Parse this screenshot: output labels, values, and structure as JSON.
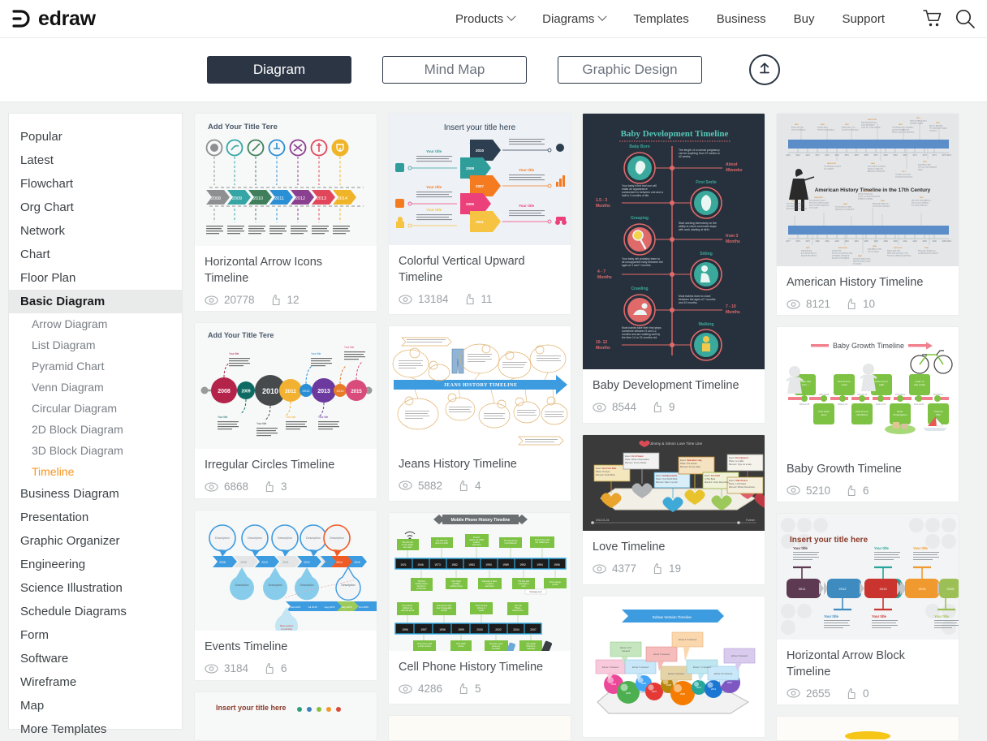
{
  "header": {
    "brand": "edraw",
    "nav": [
      {
        "label": "Products",
        "caret": true
      },
      {
        "label": "Diagrams",
        "caret": true
      },
      {
        "label": "Templates",
        "caret": false
      },
      {
        "label": "Business",
        "caret": false
      },
      {
        "label": "Buy",
        "caret": false
      },
      {
        "label": "Support",
        "caret": false
      }
    ],
    "icons": [
      {
        "name": "cart-icon"
      },
      {
        "name": "search-icon"
      }
    ]
  },
  "switchbar": {
    "buttons": [
      {
        "label": "Diagram",
        "active": true
      },
      {
        "label": "Mind Map",
        "active": false
      },
      {
        "label": "Graphic Design",
        "active": false
      }
    ],
    "upload_icon": "upload-icon"
  },
  "sidebar": {
    "items": [
      {
        "label": "Popular",
        "type": "top"
      },
      {
        "label": "Latest",
        "type": "top"
      },
      {
        "label": "Flowchart",
        "type": "top"
      },
      {
        "label": "Org Chart",
        "type": "top"
      },
      {
        "label": "Network",
        "type": "top"
      },
      {
        "label": "Chart",
        "type": "top"
      },
      {
        "label": "Floor Plan",
        "type": "top"
      },
      {
        "label": "Basic Diagram",
        "type": "top",
        "active": true
      },
      {
        "label": "Arrow Diagram",
        "type": "sub"
      },
      {
        "label": "List Diagram",
        "type": "sub"
      },
      {
        "label": "Pyramid Chart",
        "type": "sub"
      },
      {
        "label": "Venn Diagram",
        "type": "sub"
      },
      {
        "label": "Circular Diagram",
        "type": "sub"
      },
      {
        "label": "2D Block Diagram",
        "type": "sub"
      },
      {
        "label": "3D Block Diagram",
        "type": "sub"
      },
      {
        "label": "Timeline",
        "type": "sub",
        "selected": true
      },
      {
        "label": "Business Diagram",
        "type": "top"
      },
      {
        "label": "Presentation",
        "type": "top"
      },
      {
        "label": "Graphic Organizer",
        "type": "top"
      },
      {
        "label": "Engineering",
        "type": "top"
      },
      {
        "label": "Science Illustration",
        "type": "top"
      },
      {
        "label": "Schedule Diagrams",
        "type": "top"
      },
      {
        "label": "Form",
        "type": "top"
      },
      {
        "label": "Software",
        "type": "top"
      },
      {
        "label": "Wireframe",
        "type": "top"
      },
      {
        "label": "Map",
        "type": "top"
      },
      {
        "label": "More Templates",
        "type": "top"
      }
    ]
  },
  "colors": {
    "accent": "#f7941e",
    "dark": "#2b3544",
    "card_bg": "#ffffff",
    "page_bg": "#f1f3f3"
  },
  "cards": {
    "c1": {
      "title": "Horizontal Arrow Icons Timeline",
      "views": "20778",
      "likes": "12",
      "thumb_title": "Add Your Title Tere",
      "years": [
        "2008",
        "2009",
        "2010",
        "2011",
        "2012",
        "2013",
        "2014"
      ],
      "arrow_colors": [
        "#8d8f91",
        "#35a5a5",
        "#3f7f5c",
        "#2a8fd4",
        "#8b3f8f",
        "#e2465a",
        "#f0b429"
      ]
    },
    "c2": {
      "title": "Irregular Circles Timeline",
      "views": "6868",
      "likes": "3",
      "thumb_title": "Add Your Title Tere",
      "years": [
        "2008",
        "2009",
        "2010",
        "2011",
        "",
        "2013",
        "",
        "2015"
      ],
      "circle_colors": [
        "#b4234a",
        "#0d6b63",
        "#474a4d",
        "#f2b131",
        "#2a8fd4",
        "#6c3a9e",
        "#e87b26",
        "#d94b7a"
      ]
    },
    "c3": {
      "title": "Events Timeline",
      "views": "3184",
      "likes": "6",
      "bubble_label": "Description",
      "seg_years": [
        "2008",
        "2009",
        "2010",
        "2011",
        "2012",
        "2013",
        "2014",
        "2015"
      ],
      "lower_labels": [
        "Feb 2015",
        "Jul 2015",
        "Aug 2015",
        "Sep 2015",
        "Oct 2015"
      ],
      "drop_label": "New version is coming!"
    },
    "c4": {
      "title": "Colorful Vertical Upward Timeline",
      "views": "13184",
      "likes": "11",
      "thumb_title": "Insert your title here",
      "years": [
        "2010",
        "2008",
        "2007",
        "2009",
        "2011"
      ],
      "side_label": "Your title",
      "colors": [
        "#2c3e50",
        "#2f9e9b",
        "#f47b20",
        "#ec407a",
        "#f6c343"
      ]
    },
    "c5": {
      "title": "Jeans History Timeline",
      "views": "5882",
      "likes": "4",
      "banner": "JEANS HISTORY TIMELINE"
    },
    "c6": {
      "title": "Cell Phone History Timeline",
      "views": "4286",
      "likes": "5",
      "banner": "Mobile Phone History Timeline",
      "row1_years": [
        "1921",
        "1946",
        "1973",
        "1982",
        "1983",
        "1990",
        "1989",
        "1992",
        "1994",
        "1996"
      ],
      "row2_years": [
        "1996",
        "1997",
        "1998",
        "1999",
        "2000",
        "2002",
        "2004",
        "2007"
      ],
      "row1_top": [
        "The first car to car radios are used",
        "The first cell phone is  tried",
        "French  radio car 2000  system launched",
        "The dip phone is introduced",
        "First phone with the Nokia tone"
      ],
      "row1_bot": [
        "The first mobile phone service is conducted",
        "First hand portable mobile phone",
        "Germany's Netz C system launched",
        "The first text message is sent",
        "First orange phone"
      ],
      "row2_top": [
        "First phone without an external aerial",
        "First phone with inter-changeable facials",
        "First camera phone is made",
        "The cell Phone  Rescue Act"
      ],
      "row2_bot": [
        "First phone with a color screen",
        "First WAP phone",
        "The first smart phone is invented",
        "The Apple iPhone is released"
      ]
    },
    "c7": {
      "title": "Baby Development Timeline",
      "views": "8544",
      "likes": "9",
      "thumb_title": "Baby Development Timeline",
      "stages": [
        {
          "label": "Baby Born",
          "side": "About 40weeks",
          "note": "The length of a normal pregnancy can be anything from 37 weeks to 42 weeks."
        },
        {
          "label": "First Smile",
          "side": "1.5 - 3 Months",
          "note": "Your baby's first real one will make an appearance somewhere in between one and a half to 3 months of life."
        },
        {
          "label": "Grasping",
          "side": "from 3 Months",
          "note": "Start working intensively on the ability to reach and make leaps with work starting at birth."
        },
        {
          "label": "Sitting",
          "side": "4 - 7 Months",
          "note": "Your baby will probably learn to sit unsupported early between the ages of 4 and 7 months."
        },
        {
          "label": "Crawling",
          "side": "7 - 10 Months",
          "note": "Most babies learn to crawl between the ages of 7 months and 10 months."
        },
        {
          "label": "Walking",
          "side": "10- 12 Months",
          "note": "Most babies take their first steps sometime between 9 and 12 months and are walking well by the time 14 or 15 months old."
        }
      ]
    },
    "c8": {
      "title": "Love Timeline",
      "views": "4377",
      "likes": "19",
      "banner": "Jimmy & Simon  Love Time Line",
      "events": [
        "Our First Date",
        "First Flower",
        "Holding Hands",
        "Valentine's Day",
        "First Gift",
        "First Quarrel",
        "Take Photos"
      ],
      "start_date": "2012-01-15",
      "end_label": "Forever"
    },
    "c9": {
      "title": "",
      "views": "",
      "likes": "",
      "banner": "Edraw Version Timeline",
      "labels": [
        "Edraw 3 released",
        "Edraw 4.0.0 released",
        "Edraw 5 released",
        "Edraw 6 released",
        "Edraw 8.0 released",
        "Edraw 4 released",
        "Edraw 7 released",
        "Edraw 8.0 released",
        "Edraw 9 released"
      ]
    },
    "c10": {
      "title": "American History Timeline",
      "views": "8121",
      "likes": "10",
      "thumb_title": "American History Timeline in the 17th Century",
      "row1_start": "1621",
      "row1_end": "1676",
      "row2_start": "1677",
      "row2_end": "1699"
    },
    "c11": {
      "title": "Baby Growth Timeline",
      "views": "5210",
      "likes": "6",
      "thumb_title": "Baby Growth Timeline",
      "events_top": [
        "Today was born !",
        "First time to crawl",
        "First time to walk",
        "Learn to ride a bike"
      ],
      "events_bottom": [
        "First tooth grew",
        "First time to call Mama",
        "Enter Kindergarten",
        "Travel to Bali"
      ]
    },
    "c12": {
      "title": "Horizontal Arrow Block Timeline",
      "views": "2655",
      "likes": "0",
      "thumb_title": "Insert your title here",
      "block_labels": [
        "2011",
        "2012",
        "2013",
        "2014",
        "2015",
        "2016"
      ],
      "your_title": "Your title",
      "colors": [
        "#5d3a52",
        "#3d8bbf",
        "#26a69a",
        "#c9342f",
        "#f0992e",
        "#9cc055"
      ]
    },
    "c13": {
      "title": "",
      "views": "",
      "likes": "",
      "thumb_title": "Insert your title here"
    }
  },
  "icon_names": {
    "views": "eye-icon",
    "likes": "thumbs-up-icon"
  }
}
